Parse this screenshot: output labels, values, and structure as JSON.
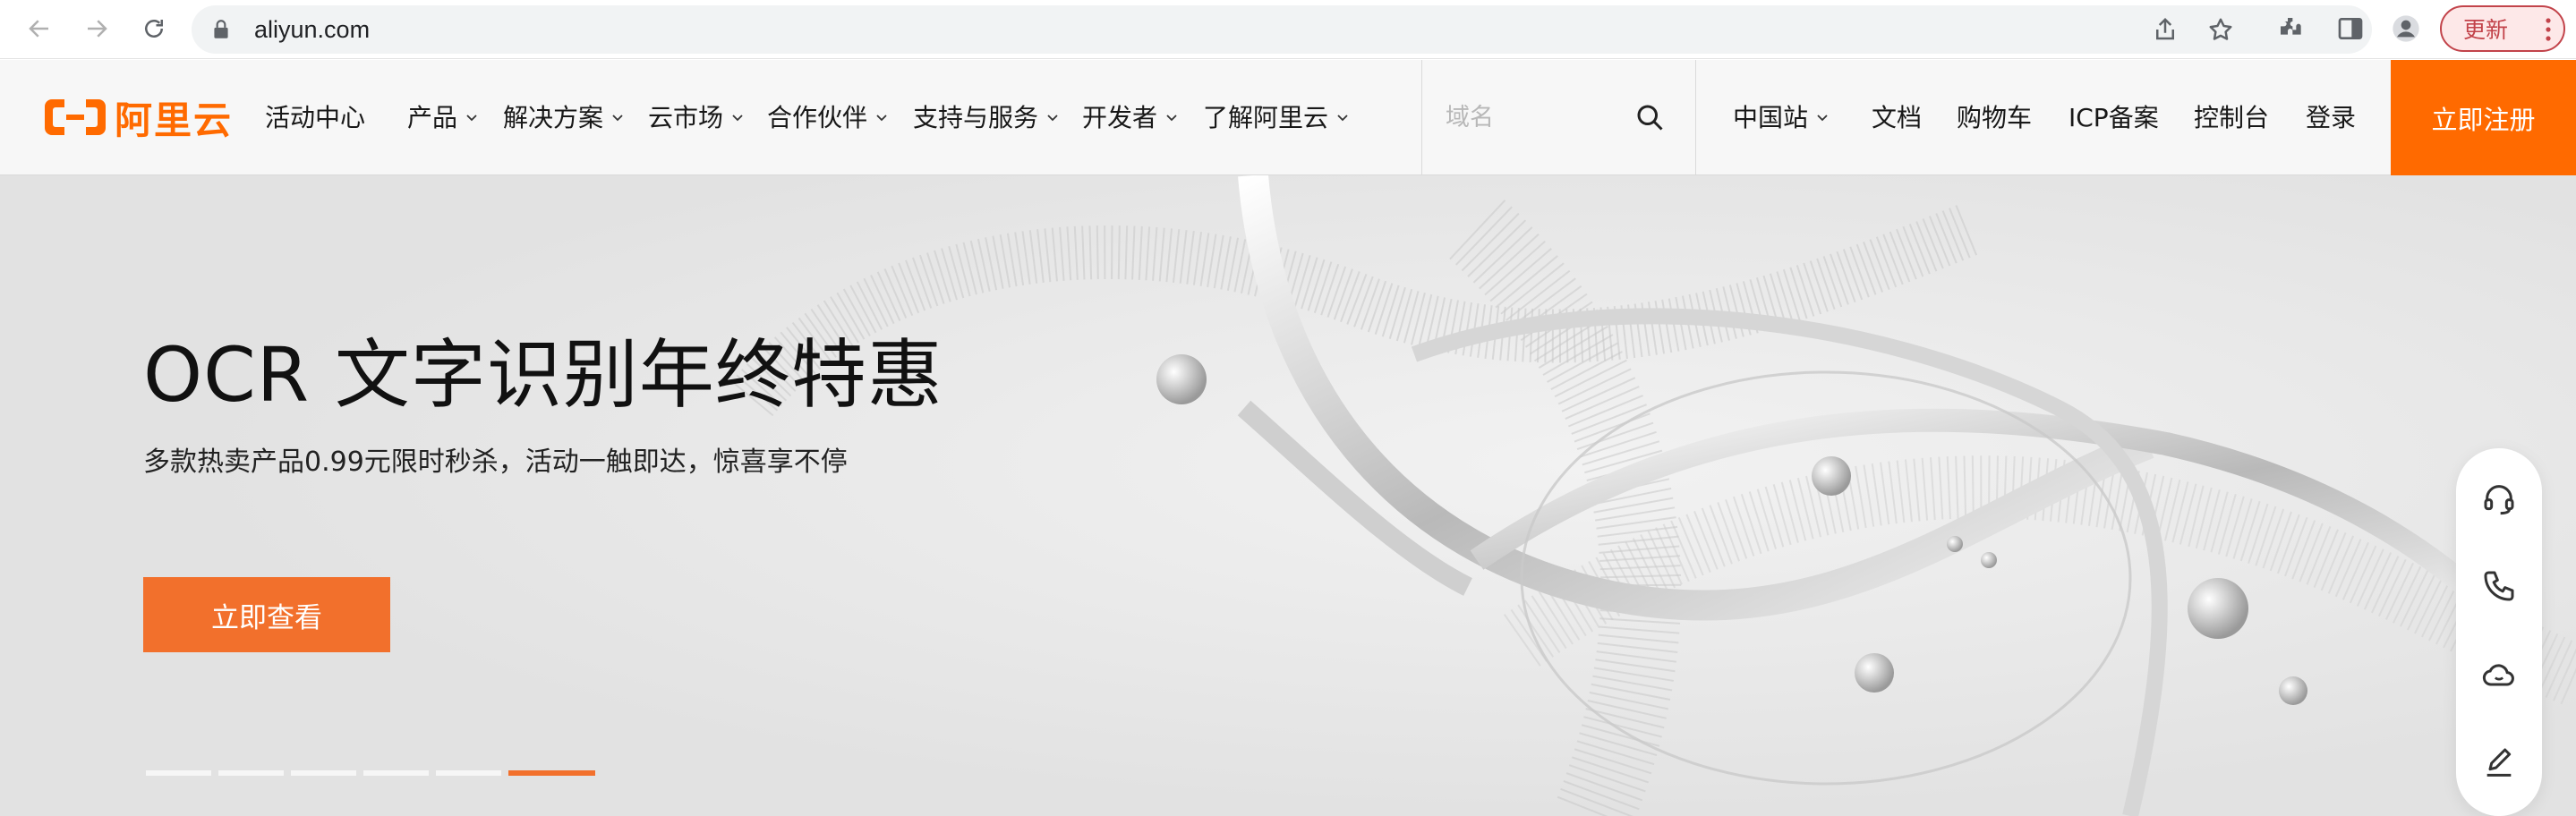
{
  "browser": {
    "url": "aliyun.com",
    "update_label": "更新",
    "icons": [
      "back-icon",
      "forward-icon",
      "reload-icon",
      "lock-icon",
      "share-icon",
      "star-icon",
      "extensions-icon",
      "sidepanel-icon",
      "profile-icon",
      "menu-icon"
    ]
  },
  "header": {
    "logo_text": "阿里云",
    "activity_center": "活动中心",
    "menu": [
      "产品",
      "解决方案",
      "云市场",
      "合作伙伴",
      "支持与服务",
      "开发者",
      "了解阿里云"
    ],
    "search_placeholder": "域名",
    "right_links": {
      "region": "中国站",
      "docs": "文档",
      "cart": "购物车",
      "icp": "ICP备案",
      "console": "控制台",
      "login": "登录"
    },
    "register_label": "立即注册"
  },
  "hero": {
    "title": "OCR 文字识别年终特惠",
    "subtitle": "多款热卖产品0.99元限时秒杀，活动一触即达，惊喜享不停",
    "cta_label": "立即查看",
    "slide_count": 6,
    "active_slide": 6
  },
  "side_toolbar": {
    "icons": [
      "headset-icon",
      "phone-icon",
      "cloud-chat-icon",
      "edit-icon"
    ]
  },
  "colors": {
    "brand": "#ff6a00",
    "cta": "#f2702c",
    "update": "#c2434a"
  }
}
